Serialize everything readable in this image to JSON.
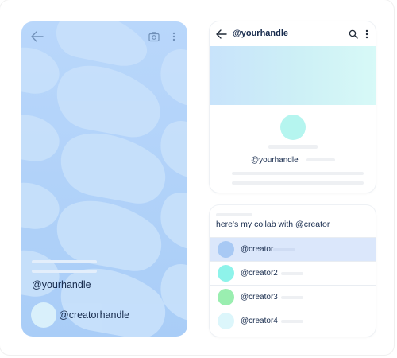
{
  "left_phone": {
    "handle": "@yourhandle",
    "creator": "@creatorhandle",
    "icons": [
      "back-arrow-icon",
      "camera-icon",
      "more-vertical-icon"
    ],
    "colors": {
      "background": "#b9d7fb",
      "shapes": "#c9e2fb",
      "avatar": "#d9f0fb"
    }
  },
  "profile_card": {
    "title": "@yourhandle",
    "handle": "@yourhandle",
    "icons": [
      "back-arrow-icon",
      "search-icon",
      "more-vertical-icon"
    ],
    "colors": {
      "banner_start": "#c8e3fb",
      "banner_end": "#d7f9f7",
      "avatar": "#b5f5ef"
    }
  },
  "collab_card": {
    "title": "here's my collab with @creator",
    "items": [
      {
        "label": "@creator",
        "color": "#a8c9f4",
        "selected": true
      },
      {
        "label": "@creator2",
        "color": "#8ef3ea",
        "selected": false
      },
      {
        "label": "@creator3",
        "color": "#9aeeb0",
        "selected": false
      },
      {
        "label": "@creator4",
        "color": "#dcf6fb",
        "selected": false
      }
    ]
  }
}
